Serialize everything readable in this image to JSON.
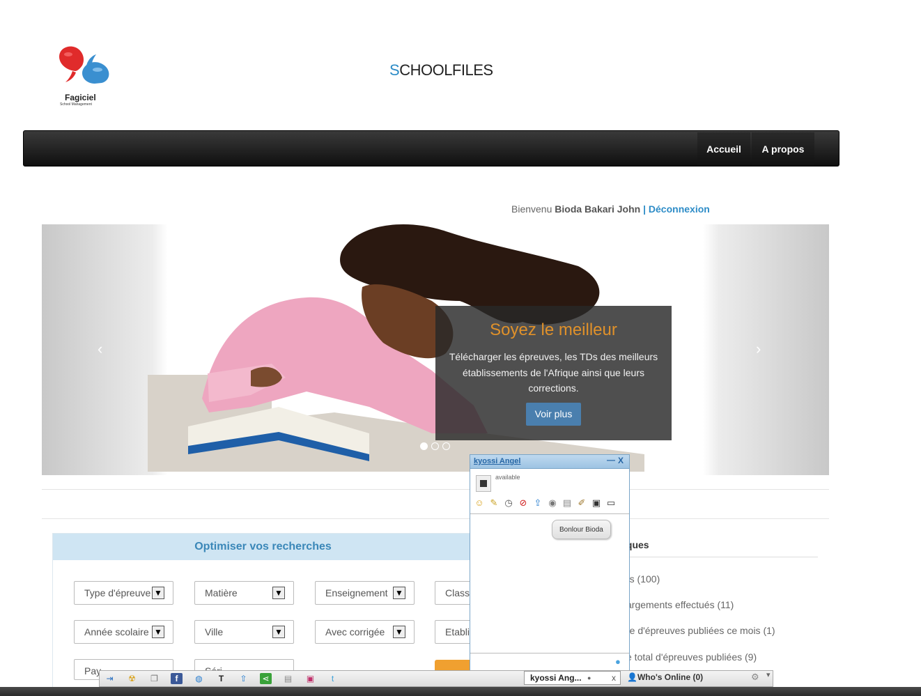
{
  "logo": {
    "brand": "Fagiciel",
    "tagline": "School Management"
  },
  "site": {
    "title_first": "S",
    "title_rest": "CHOOLFILES"
  },
  "nav": {
    "items": [
      "Accueil",
      "A propos"
    ]
  },
  "welcome": {
    "prefix": "Bienvenu",
    "user": "Bioda Bakari John",
    "separator": "|",
    "logout": "Déconnexion"
  },
  "carousel": {
    "prev": "‹",
    "next": "›",
    "caption_title": "Soyez le meilleur",
    "caption_text": "Télécharger les épreuves, les TDs des meilleurs établissements de l'Afrique ainsi que leurs corrections.",
    "button": "Voir plus",
    "slides": 3,
    "active": 1
  },
  "search": {
    "title": "Optimiser vos recherches",
    "selects": [
      "Type d'épreuve",
      "Matière",
      "Enseignement",
      "Classe",
      "Année scolaire",
      "Ville",
      "Avec corrigée",
      "Etabli",
      "Pay",
      "Séri"
    ]
  },
  "stats": {
    "title": "iques",
    "lines": [
      "rs (100)",
      "argements effectués (11)",
      "re d'épreuves publiées ce mois (1)",
      "e total d'épreuves publiées (9)"
    ]
  },
  "chat": {
    "name": "kyossi Angel",
    "status": "available",
    "message": "Bonlour Bioda",
    "minimize": "—",
    "close": "X"
  },
  "bottom_bar": {
    "chat_tab": "kyossi Ang...",
    "chat_tab_close": "x",
    "whos_online": "Who's Online (0)"
  }
}
